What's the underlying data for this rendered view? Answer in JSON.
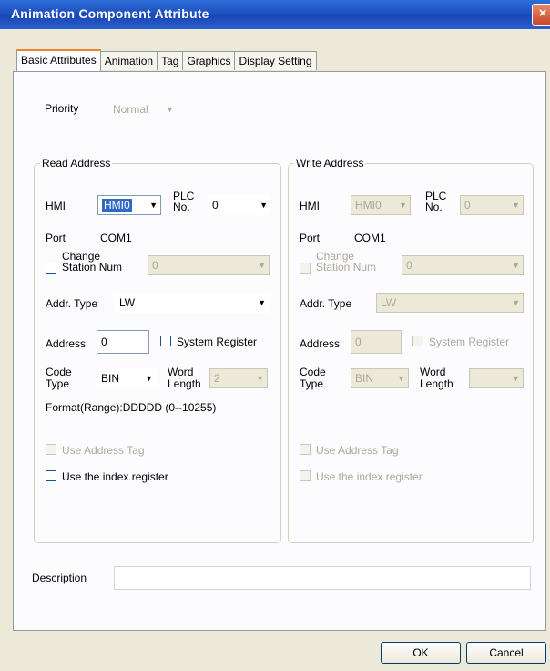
{
  "window": {
    "title": "Animation Component Attribute",
    "close_icon": "×"
  },
  "tabs": [
    "Basic Attributes",
    "Animation",
    "Tag",
    "Graphics",
    "Display Setting"
  ],
  "priority": {
    "label": "Priority",
    "value": "Normal"
  },
  "read": {
    "group_title": "Read Address",
    "hmi_label": "HMI",
    "hmi_value": "HMI0",
    "plc_label_1": "PLC",
    "plc_label_2": "No.",
    "plc_value": "0",
    "port_label": "Port",
    "port_value": "COM1",
    "change_label_1": "Change",
    "change_label_2": "Station Num",
    "station_value": "0",
    "addr_type_label": "Addr. Type",
    "addr_type_value": "LW",
    "address_label": "Address",
    "address_value": "0",
    "sysreg_label": "System Register",
    "code_label_1": "Code",
    "code_label_2": "Type",
    "code_value": "BIN",
    "word_label_1": "Word",
    "word_label_2": "Length",
    "word_value": "2",
    "format_text": "Format(Range):DDDDD (0--10255)",
    "use_tag_label": "Use Address Tag",
    "use_index_label": "Use the index register"
  },
  "write": {
    "group_title": "Write Address",
    "hmi_label": "HMI",
    "hmi_value": "HMI0",
    "plc_label_1": "PLC",
    "plc_label_2": "No.",
    "plc_value": "0",
    "port_label": "Port",
    "port_value": "COM1",
    "change_label_1": "Change",
    "change_label_2": "Station Num",
    "station_value": "0",
    "addr_type_label": "Addr. Type",
    "addr_type_value": "LW",
    "address_label": "Address",
    "address_value": "0",
    "sysreg_label": "System Register",
    "code_label_1": "Code",
    "code_label_2": "Type",
    "code_value": "BIN",
    "word_label_1": "Word",
    "word_label_2": "Length",
    "word_value": "",
    "use_tag_label": "Use Address Tag",
    "use_index_label": "Use the index register"
  },
  "description": {
    "label": "Description",
    "value": ""
  },
  "buttons": {
    "ok": "OK",
    "cancel": "Cancel"
  }
}
